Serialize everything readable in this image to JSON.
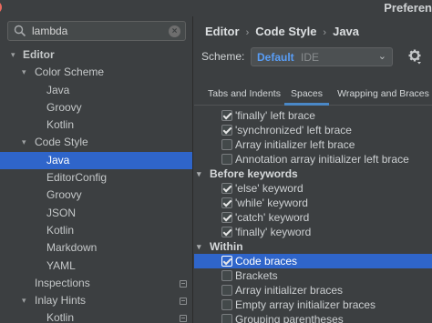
{
  "window": {
    "title": "Preferen",
    "controls": [
      {
        "name": "close",
        "color": "#ec6a5e"
      },
      {
        "name": "minimize",
        "color": "#f4bf4f"
      },
      {
        "name": "maximize",
        "color": "#61c554"
      }
    ]
  },
  "search": {
    "value": "lambda",
    "placeholder": ""
  },
  "tree": [
    {
      "label": "Editor",
      "level": 0,
      "arrow": "▾",
      "bold": true
    },
    {
      "label": "Color Scheme",
      "level": 1,
      "arrow": "▾"
    },
    {
      "label": "Java",
      "level": 2
    },
    {
      "label": "Groovy",
      "level": 2
    },
    {
      "label": "Kotlin",
      "level": 2
    },
    {
      "label": "Code Style",
      "level": 1,
      "arrow": "▾"
    },
    {
      "label": "Java",
      "level": 2,
      "selected": true
    },
    {
      "label": "EditorConfig",
      "level": 2
    },
    {
      "label": "Groovy",
      "level": 2
    },
    {
      "label": "JSON",
      "level": 2
    },
    {
      "label": "Kotlin",
      "level": 2
    },
    {
      "label": "Markdown",
      "level": 2
    },
    {
      "label": "YAML",
      "level": 2
    },
    {
      "label": "Inspections",
      "level": 1,
      "badge": true
    },
    {
      "label": "Inlay Hints",
      "level": 1,
      "arrow": "▾",
      "badge": true
    },
    {
      "label": "Kotlin",
      "level": 2,
      "badge": true
    }
  ],
  "breadcrumb": [
    "Editor",
    "Code Style",
    "Java"
  ],
  "scheme": {
    "label": "Scheme:",
    "value": "Default",
    "sub": "IDE"
  },
  "tabs": [
    "Tabs and Indents",
    "Spaces",
    "Wrapping and Braces"
  ],
  "active_tab": "Spaces",
  "settings": [
    {
      "type": "item",
      "label": "'finally' left brace",
      "checked": true
    },
    {
      "type": "item",
      "label": "'synchronized' left brace",
      "checked": true
    },
    {
      "type": "item",
      "label": "Array initializer left brace",
      "checked": false
    },
    {
      "type": "item",
      "label": "Annotation array initializer left brace",
      "checked": false
    },
    {
      "type": "group",
      "label": "Before keywords"
    },
    {
      "type": "item",
      "label": "'else' keyword",
      "checked": true
    },
    {
      "type": "item",
      "label": "'while' keyword",
      "checked": true
    },
    {
      "type": "item",
      "label": "'catch' keyword",
      "checked": true
    },
    {
      "type": "item",
      "label": "'finally' keyword",
      "checked": true
    },
    {
      "type": "group",
      "label": "Within"
    },
    {
      "type": "item",
      "label": "Code braces",
      "checked": true,
      "highlight": true
    },
    {
      "type": "item",
      "label": "Brackets",
      "checked": false
    },
    {
      "type": "item",
      "label": "Array initializer braces",
      "checked": false
    },
    {
      "type": "item",
      "label": "Empty array initializer braces",
      "checked": false
    },
    {
      "type": "item",
      "label": "Grouping parentheses",
      "checked": false
    }
  ],
  "colors": {
    "selection": "#2f65ca",
    "link": "#589df6",
    "background": "#3c3f41"
  }
}
